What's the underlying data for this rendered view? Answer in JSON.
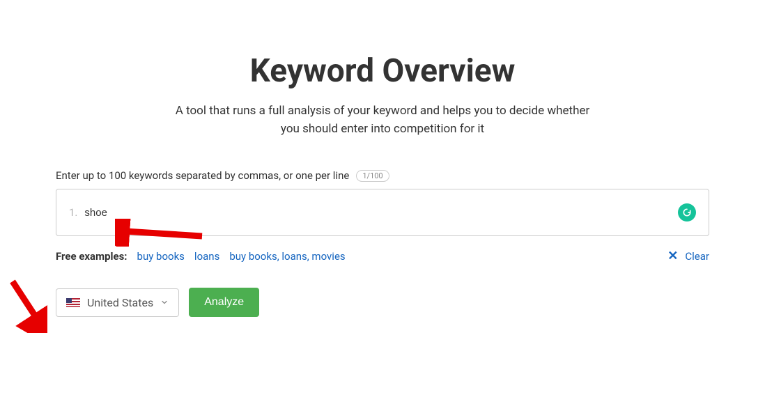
{
  "header": {
    "title": "Keyword Overview",
    "subtitle": "A tool that runs a full analysis of your keyword and helps you to decide whether you should enter into competition for it"
  },
  "input": {
    "label": "Enter up to 100 keywords separated by commas, or one per line",
    "count_badge": "1/100",
    "line_number": "1.",
    "value": "shoe"
  },
  "examples": {
    "label": "Free examples:",
    "items": [
      "buy books",
      "loans",
      "buy books, loans, movies"
    ]
  },
  "clear": {
    "label": "Clear"
  },
  "country": {
    "selected": "United States"
  },
  "analyze": {
    "label": "Analyze"
  }
}
